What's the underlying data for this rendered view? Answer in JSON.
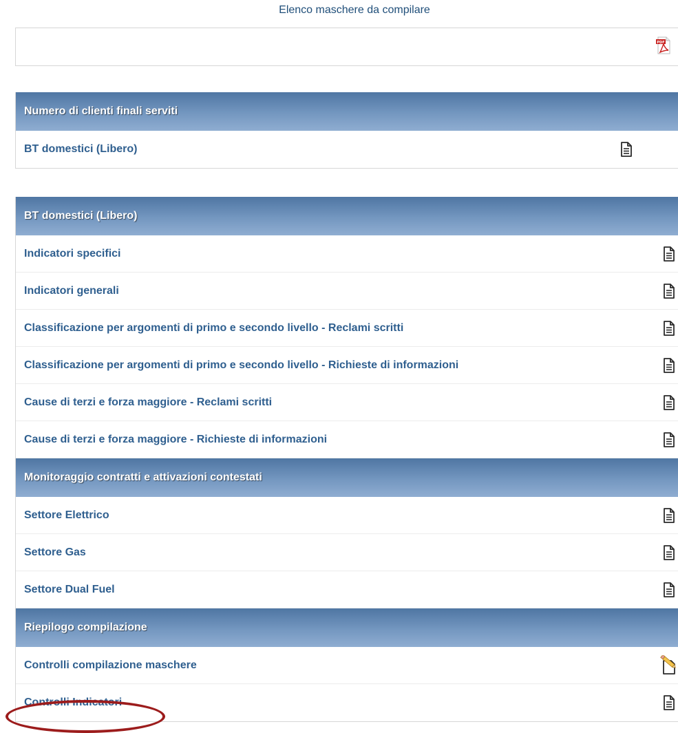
{
  "page_title": "Elenco maschere da compilare",
  "pdf_icon": "pdf-icon",
  "table1": {
    "header": "Numero di clienti finali serviti",
    "rows": [
      {
        "label": "BT domestici (Libero)",
        "icon": "document-icon"
      }
    ]
  },
  "table2": {
    "sections": [
      {
        "header": "BT domestici (Libero)",
        "rows": [
          {
            "label": "Indicatori specifici",
            "icon": "document-icon"
          },
          {
            "label": "Indicatori generali",
            "icon": "document-icon"
          },
          {
            "label": "Classificazione per argomenti di primo e secondo livello - Reclami scritti",
            "icon": "document-icon"
          },
          {
            "label": "Classificazione per argomenti di primo e secondo livello - Richieste di informazioni",
            "icon": "document-icon"
          },
          {
            "label": "Cause di terzi e forza maggiore - Reclami scritti",
            "icon": "document-icon"
          },
          {
            "label": "Cause di terzi e forza maggiore - Richieste di informazioni",
            "icon": "document-icon"
          }
        ]
      },
      {
        "header": "Monitoraggio contratti e attivazioni contestati",
        "rows": [
          {
            "label": "Settore Elettrico",
            "icon": "document-icon"
          },
          {
            "label": "Settore Gas",
            "icon": "document-icon"
          },
          {
            "label": "Settore Dual Fuel",
            "icon": "document-icon"
          }
        ]
      },
      {
        "header": "Riepilogo compilazione",
        "rows": [
          {
            "label": "Controlli compilazione maschere",
            "icon": "edit-document-icon"
          },
          {
            "label": "Controlli Indicatori",
            "icon": "document-icon",
            "highlighted": true
          }
        ]
      }
    ]
  },
  "colors": {
    "header_gradient_top": "#4f76a3",
    "header_gradient_bottom": "#8fadd1",
    "link_text": "#2f5f8f",
    "highlight_ellipse": "#9c1c1c"
  }
}
